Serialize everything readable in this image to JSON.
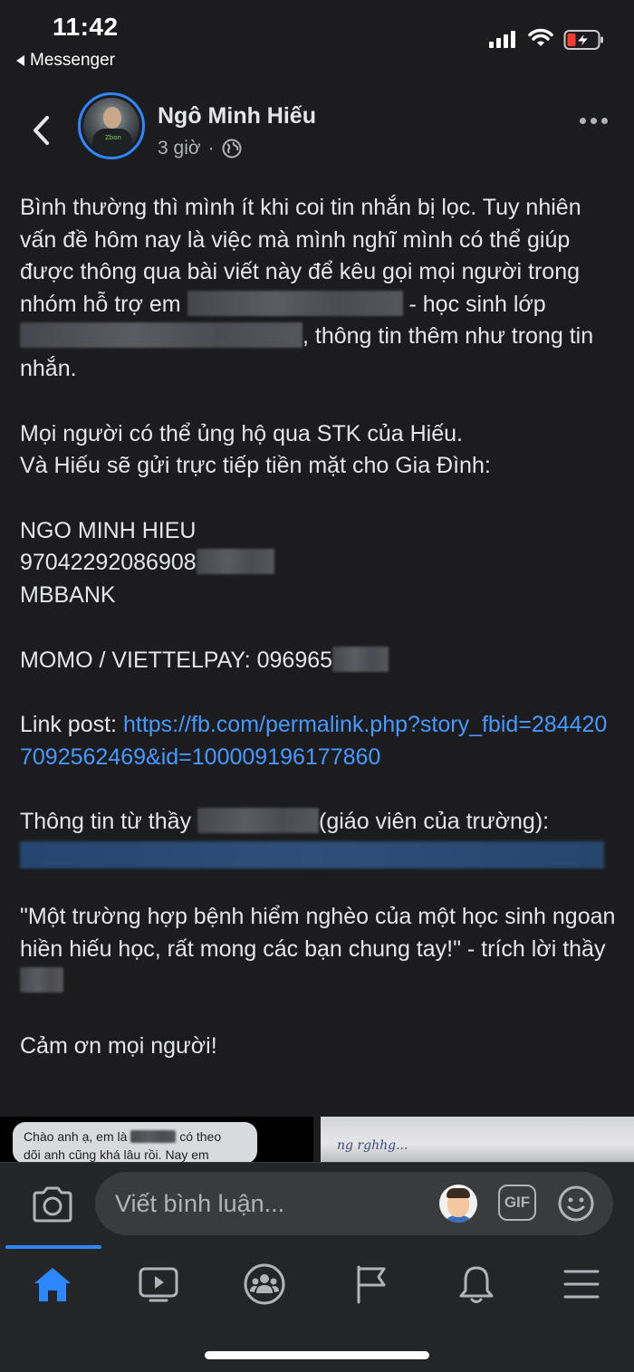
{
  "status_bar": {
    "time": "11:42",
    "back_app_label": "Messenger",
    "signal_icon": "signal-bars-icon",
    "wifi_icon": "wifi-icon",
    "battery_icon": "battery-charging-low-icon",
    "battery_color": "#ff3b30"
  },
  "post": {
    "author": "Ngô Minh Hiếu",
    "time_ago": "3 giờ",
    "meta_separator": "·",
    "privacy_icon": "globe-icon",
    "paragraphs": {
      "p1_a": "Bình thường thì mình ít khi coi tin nhắn bị lọc. Tuy nhiên vấn đề hôm nay là việc mà mình nghĩ mình có thể giúp được thông qua bài viết này để kêu gọi mọi người trong nhóm hỗ trợ em",
      "p1_b": "-",
      "p1_c": "học sinh lớp",
      "p1_d": ", thông tin thêm như trong tin nhắn.",
      "p2_line1": "Mọi người có thể ủng hộ qua STK của Hiếu.",
      "p2_line2": "Và Hiếu sẽ gửi trực tiếp tiền mặt cho Gia Đình:",
      "account_name": "NGO MINH HIEU",
      "account_number": "97042292086908",
      "bank": "MBBANK",
      "momo": "MOMO / VIETTELPAY: 096965",
      "link_label": "Link post:",
      "link_url": "https://fb.com/permalink.php?story_fbid=2844207092562469&id=100009196177860",
      "teacher_a": "Thông tin từ thầy",
      "teacher_b": "(giáo viên của trường):",
      "quote": "\"Một trường hợp bệnh hiểm nghèo của một học sinh ngoan hiền hiếu học, rất mong các bạn chung tay!\" - trích lời thầy",
      "thanks": "Cảm ơn mọi người!"
    }
  },
  "thumbnails": {
    "left_line1": "Chào anh ạ, em là",
    "left_line1_end": "có theo",
    "left_line2": "dõi anh cũng khá lâu rồi. Nay em"
  },
  "comment_bar": {
    "placeholder": "Viết bình luận...",
    "camera_icon": "camera-icon",
    "avatar_icon": "avatar-sticker-icon",
    "gif_label": "GIF",
    "smile_icon": "smile-icon"
  },
  "bottom_nav": {
    "items": [
      "home-icon",
      "watch-icon",
      "groups-icon",
      "pages-flag-icon",
      "notifications-bell-icon",
      "menu-icon"
    ],
    "active_color": "#2d88ff",
    "inactive_color": "#b0b3b8"
  }
}
